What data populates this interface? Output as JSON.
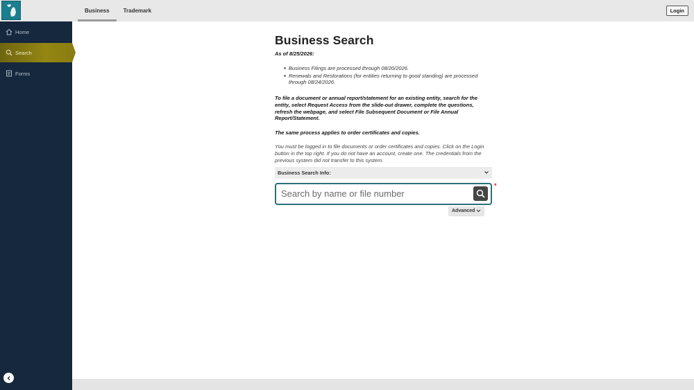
{
  "header": {
    "tabs": [
      {
        "label": "Business",
        "active": true
      },
      {
        "label": "Trademark",
        "active": false
      }
    ],
    "login_label": "Login"
  },
  "sidebar": {
    "items": [
      {
        "label": "Home",
        "icon": "home-icon"
      },
      {
        "label": "Search",
        "icon": "search-icon",
        "active": true
      },
      {
        "label": "Forms",
        "icon": "forms-icon"
      }
    ]
  },
  "main": {
    "title": "Business Search",
    "as_of": "As of 8/25/2026:",
    "bullets": [
      "Business Filings are processed through 08/20/2026.",
      "Renewals and Restorations (for entities returning to good standing) are processed through 08/24/2026."
    ],
    "instructions": "To file a document or annual report/statement for an existing entity, search for the entity, select Request Access from the slide-out drawer, complete the questions, refresh the webpage, and select File Subsequent Document or File Annual Report/Statement.",
    "same_process": "The same process applies to order certificates and copies.",
    "login_note": "You must be logged in to file documents or order certificates and copies. Click on the Login button in the top right. If you do not have an account, create one. The credentials from the previous system did not transfer to this system.",
    "info_bar_label": "Business Search Info:",
    "search": {
      "placeholder": "Search by name or file number",
      "value": ""
    },
    "required_mark": "*",
    "advanced_label": "Advanced"
  },
  "colors": {
    "sidebar_bg": "#15283d",
    "active_nav": "#948613",
    "search_border": "#2c6e7a",
    "logo_bg": "#1a7f8e"
  }
}
